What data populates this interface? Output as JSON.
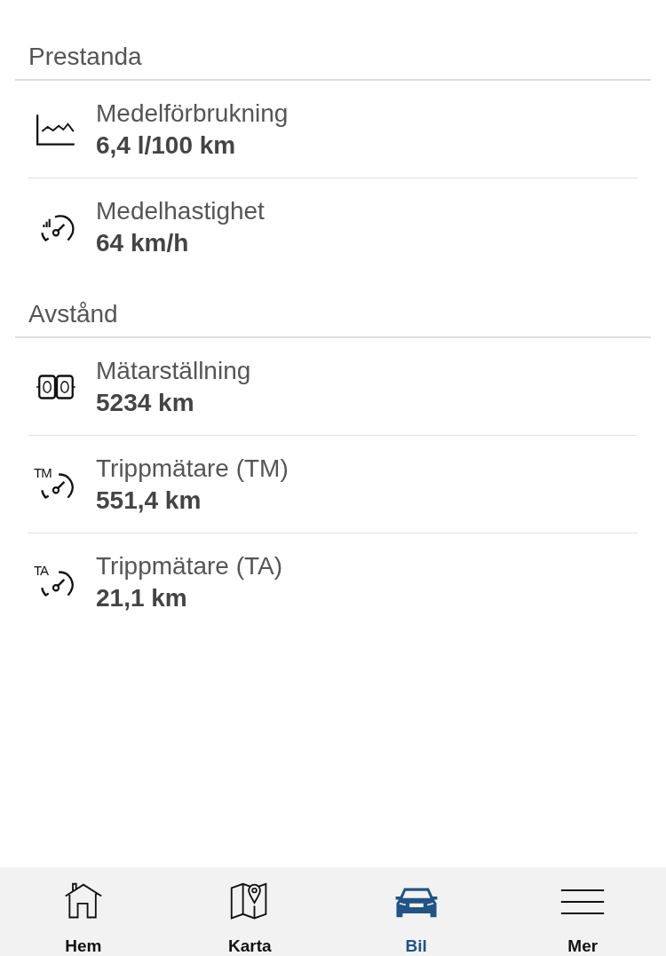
{
  "sections": [
    {
      "title": "Prestanda",
      "items": [
        {
          "kind": "chart",
          "label": "Medelförbrukning",
          "value": "6,4 l/100 km"
        },
        {
          "kind": "speed",
          "label": "Medelhastighet",
          "value": "64 km/h"
        }
      ]
    },
    {
      "title": "Avstånd",
      "items": [
        {
          "kind": "odometer",
          "label": "Mätarställning",
          "value": "5234 km"
        },
        {
          "kind": "trip",
          "icon_text": "TM",
          "label": "Trippmätare (TM)",
          "value": "551,4 km"
        },
        {
          "kind": "trip",
          "icon_text": "TA",
          "label": "Trippmätare (TA)",
          "value": "21,1 km"
        }
      ]
    }
  ],
  "tab_bar": [
    {
      "kind": "home",
      "label": "Hem",
      "selected": false
    },
    {
      "kind": "map",
      "label": "Karta",
      "selected": false
    },
    {
      "kind": "car",
      "label": "Bil",
      "selected": true
    },
    {
      "kind": "menu",
      "label": "Mer",
      "selected": false
    }
  ]
}
